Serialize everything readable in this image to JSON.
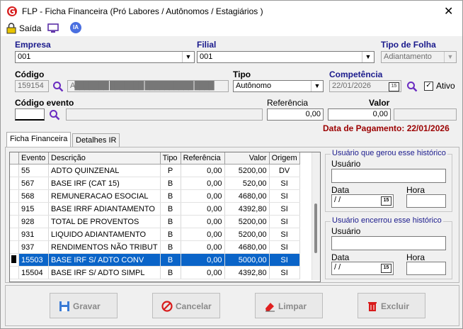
{
  "window": {
    "title": "FLP - Ficha Financeira (Pró Labores / Autônomos / Estagiários )",
    "close_glyph": "✕"
  },
  "toolbar": {
    "exit_label": "Saída",
    "ia_label": "IA"
  },
  "form": {
    "empresa_label": "Empresa",
    "empresa_value": "001",
    "filial_label": "Filial",
    "filial_value": "001",
    "tipo_folha_label": "Tipo de Folha",
    "tipo_folha_value": "Adiantamento",
    "codigo_label": "Código",
    "codigo_value": "159154",
    "nome_value": "A███████ ███████ ██████████ ████",
    "tipo_label": "Tipo",
    "tipo_value": "Autônomo",
    "competencia_label": "Competência",
    "competencia_value": "22/01/2026",
    "calendar_glyph": "15",
    "ativo_label": "Ativo",
    "ativo_checked": "✓",
    "codigo_evento_label": "Código evento",
    "referencia_label": "Referência",
    "referencia_value": "0,00",
    "valor_label": "Valor",
    "valor_value": "0,00",
    "data_pagamento": "Data de Pagamento: 22/01/2026"
  },
  "tabs": [
    {
      "label": "Ficha Financeira"
    },
    {
      "label": "Detalhes IR"
    }
  ],
  "grid": {
    "headers": [
      "Evento",
      "Descrição",
      "Tipo",
      "Referência",
      "Valor",
      "Origem"
    ],
    "rows": [
      [
        "55",
        "ADTO QUINZENAL",
        "P",
        "0,00",
        "5200,00",
        "DV"
      ],
      [
        "567",
        "BASE IRF (CAT 15)",
        "B",
        "0,00",
        "520,00",
        "SI"
      ],
      [
        "568",
        "REMUNERACAO ESOCIAL",
        "B",
        "0,00",
        "4680,00",
        "SI"
      ],
      [
        "915",
        "BASE IRRF ADIANTAMENTO",
        "B",
        "0,00",
        "4392,80",
        "SI"
      ],
      [
        "928",
        "TOTAL DE PROVENTOS",
        "B",
        "0,00",
        "5200,00",
        "SI"
      ],
      [
        "931",
        "LIQUIDO ADIANTAMENTO",
        "B",
        "0,00",
        "5200,00",
        "SI"
      ],
      [
        "937",
        "RENDIMENTOS NÃO TRIBUT",
        "B",
        "0,00",
        "4680,00",
        "SI"
      ],
      [
        "15503",
        "BASE IRF S/ ADTO CONV",
        "B",
        "0,00",
        "5000,00",
        "SI"
      ],
      [
        "15504",
        "BASE IRF S/ ADTO SIMPL",
        "B",
        "0,00",
        "4392,80",
        "SI"
      ]
    ],
    "selected_row": 7
  },
  "history_created": {
    "title": "Usuário que gerou esse histórico",
    "usuario_label": "Usuário",
    "data_label": "Data",
    "data_value": " / /",
    "hora_label": "Hora"
  },
  "history_closed": {
    "title": "Usuário encerrou esse histórico",
    "usuario_label": "Usuário",
    "data_label": "Data",
    "data_value": " / /",
    "hora_label": "Hora"
  },
  "buttons": {
    "save": "Gravar",
    "cancel": "Cancelar",
    "clear": "Limpar",
    "delete": "Excluir"
  },
  "colors": {
    "label_blue": "#1a1a8c",
    "selection": "#0a64c8",
    "payment_red": "#9b0000"
  }
}
